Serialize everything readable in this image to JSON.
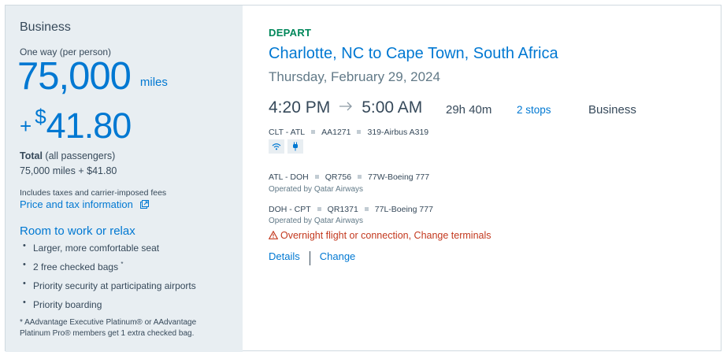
{
  "fare": {
    "cabin": "Business",
    "trip_type": "One way (per person)",
    "miles": "75,000",
    "miles_unit": "miles",
    "cash_plus": "+",
    "cash_symbol": "$",
    "cash_amount": "41.80",
    "total_label": "Total",
    "total_suffix": " (all passengers)",
    "total_value": "75,000 miles + $41.80",
    "fees_note": "Includes taxes and carrier-imposed fees",
    "price_link": "Price and tax information",
    "perks_title": "Room to work or relax",
    "perks": [
      {
        "text": "Larger, more comfortable seat",
        "sup": ""
      },
      {
        "text": "2 free checked bags ",
        "sup": "*"
      },
      {
        "text": "Priority security at participating airports",
        "sup": ""
      },
      {
        "text": "Priority boarding",
        "sup": ""
      }
    ],
    "footnote": "* AAdvantage Executive Platinum® or AAdvantage Platinum Pro® members get 1 extra checked bag."
  },
  "flight": {
    "direction": "DEPART",
    "route": "Charlotte, NC to Cape Town, South Africa",
    "date": "Thursday, February 29, 2024",
    "depart_time": "4:20 PM",
    "arrive_time": "5:00 AM",
    "duration": "29h 40m",
    "stops": "2 stops",
    "cabin": "Business",
    "segments": [
      {
        "route": "CLT - ATL",
        "flight": "AA1271",
        "aircraft": "319-Airbus A319",
        "operated_by": ""
      },
      {
        "route": "ATL - DOH",
        "flight": "QR756",
        "aircraft": "77W-Boeing 777",
        "operated_by": "Operated by Qatar Airways"
      },
      {
        "route": "DOH - CPT",
        "flight": "QR1371",
        "aircraft": "77L-Boeing 777",
        "operated_by": "Operated by Qatar Airways"
      }
    ],
    "amenities": [
      "wifi-icon",
      "power-outlet-icon"
    ],
    "warning": "Overnight flight or connection, Change terminals",
    "details_link": "Details",
    "change_link": "Change"
  },
  "colors": {
    "accent": "#0078d2",
    "depart_green": "#00875a",
    "warning_red": "#c3381e",
    "panel_bg": "#e8eef2"
  }
}
